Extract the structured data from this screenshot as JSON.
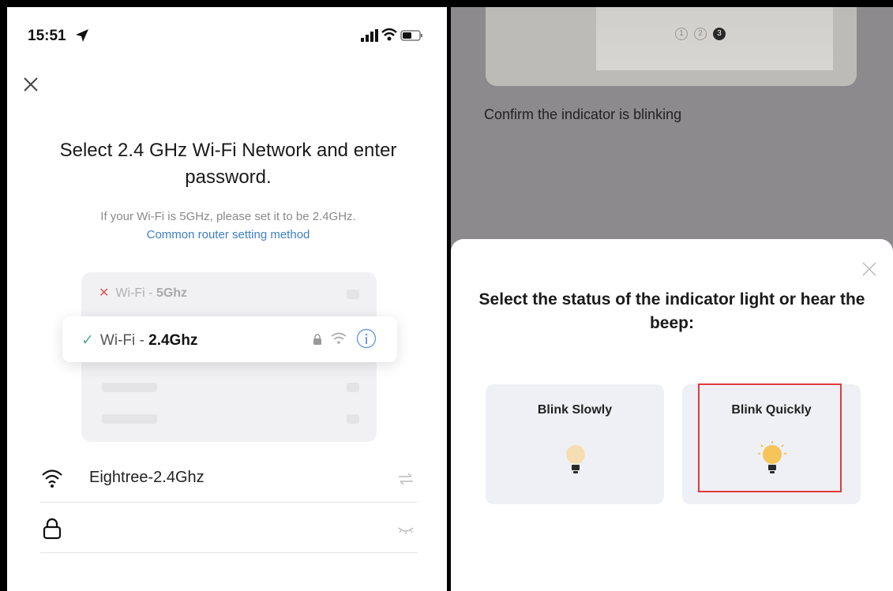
{
  "left": {
    "status": {
      "time": "15:51"
    },
    "title": "Select 2.4 GHz Wi-Fi Network and enter password.",
    "subtitle": "If your Wi-Fi is 5GHz, please set it to be 2.4GHz.",
    "router_link": "Common router setting method",
    "illustration": {
      "bad_prefix": "Wi-Fi - ",
      "bad_band": "5Ghz",
      "good_prefix": "Wi-Fi - ",
      "good_band": "2.4Ghz"
    },
    "ssid_value": "Eightree-2.4Ghz",
    "password_value": ""
  },
  "right": {
    "confirm_text": "Confirm the indicator is blinking",
    "steps": [
      "1",
      "2",
      "3"
    ],
    "sheet_title": "Select the status of the indicator light or hear the beep:",
    "option_slow": "Blink Slowly",
    "option_quick": "Blink Quickly"
  },
  "colors": {
    "link": "#3d7fc6",
    "check": "#55b08a",
    "x_mark": "#e05555",
    "highlight": "#e03c3c",
    "bulb": "#f5c55a"
  },
  "icons": [
    "location-arrow-icon",
    "signal-icon",
    "wifi-icon",
    "battery-icon",
    "close-icon",
    "lock-icon",
    "info-icon",
    "switch-icon",
    "eye-closed-icon",
    "bulb-icon"
  ]
}
